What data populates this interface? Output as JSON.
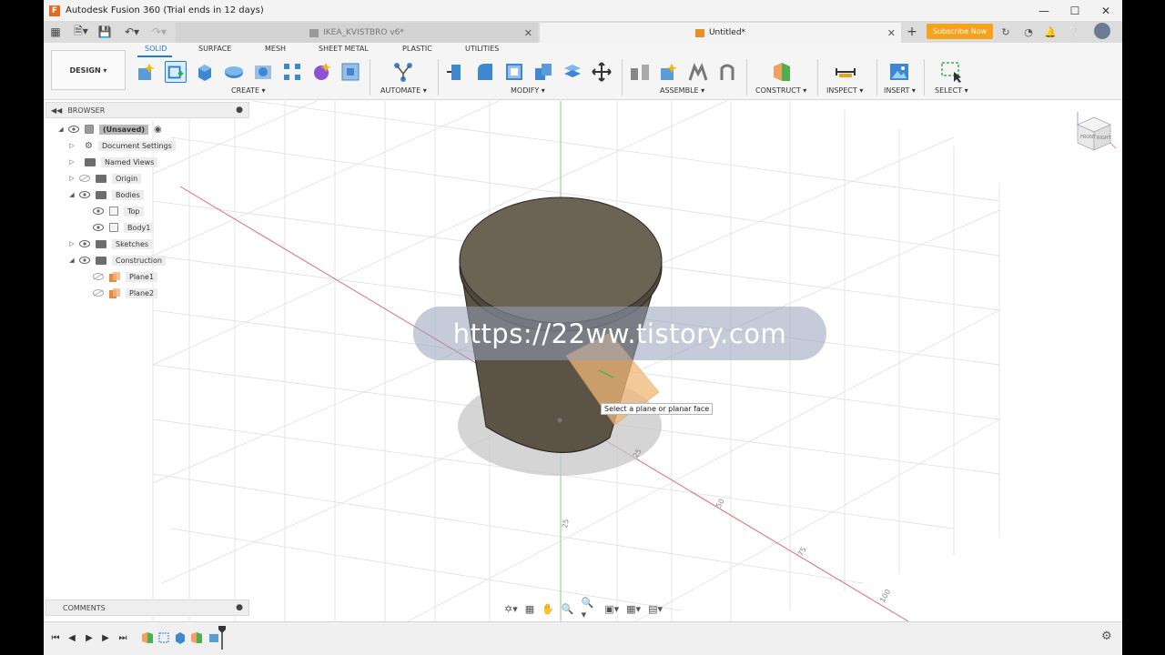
{
  "window": {
    "title": "Autodesk Fusion 360 (Trial ends in 12 days)",
    "controls": [
      "minimize",
      "maximize",
      "close"
    ]
  },
  "tabs": [
    {
      "label": "IKEA_KVISTBRO v6*",
      "active": false
    },
    {
      "label": "Untitled*",
      "active": true
    }
  ],
  "header_right": {
    "subscribe_label": "Subscribe Now"
  },
  "ribbon": {
    "workspace": "DESIGN",
    "tabs": [
      "SOLID",
      "SURFACE",
      "MESH",
      "SHEET METAL",
      "PLASTIC",
      "UTILITIES"
    ],
    "active_tab": "SOLID",
    "groups": [
      "CREATE",
      "AUTOMATE",
      "MODIFY",
      "ASSEMBLE",
      "CONSTRUCT",
      "INSPECT",
      "INSERT",
      "SELECT"
    ]
  },
  "browser": {
    "title": "BROWSER",
    "root": "(Unsaved)",
    "items": [
      {
        "label": "Document Settings"
      },
      {
        "label": "Named Views"
      },
      {
        "label": "Origin"
      },
      {
        "label": "Bodies"
      },
      {
        "label": "Top"
      },
      {
        "label": "Body1"
      },
      {
        "label": "Sketches"
      },
      {
        "label": "Construction"
      },
      {
        "label": "Plane1"
      },
      {
        "label": "Plane2"
      }
    ]
  },
  "comments": {
    "title": "COMMENTS"
  },
  "viewport": {
    "watermark": "https://22ww.tistory.com",
    "tooltip": "Select a plane or planar face",
    "axis_labels": [
      "25",
      "50",
      "75",
      "100",
      "25"
    ],
    "viewcube": {
      "front": "FRONT",
      "right": "RIGHT"
    }
  },
  "colors": {
    "accent": "#1a7fd3",
    "subscribe": "#f7a21b",
    "body": "#5b5345",
    "plane": "#f0b878"
  }
}
